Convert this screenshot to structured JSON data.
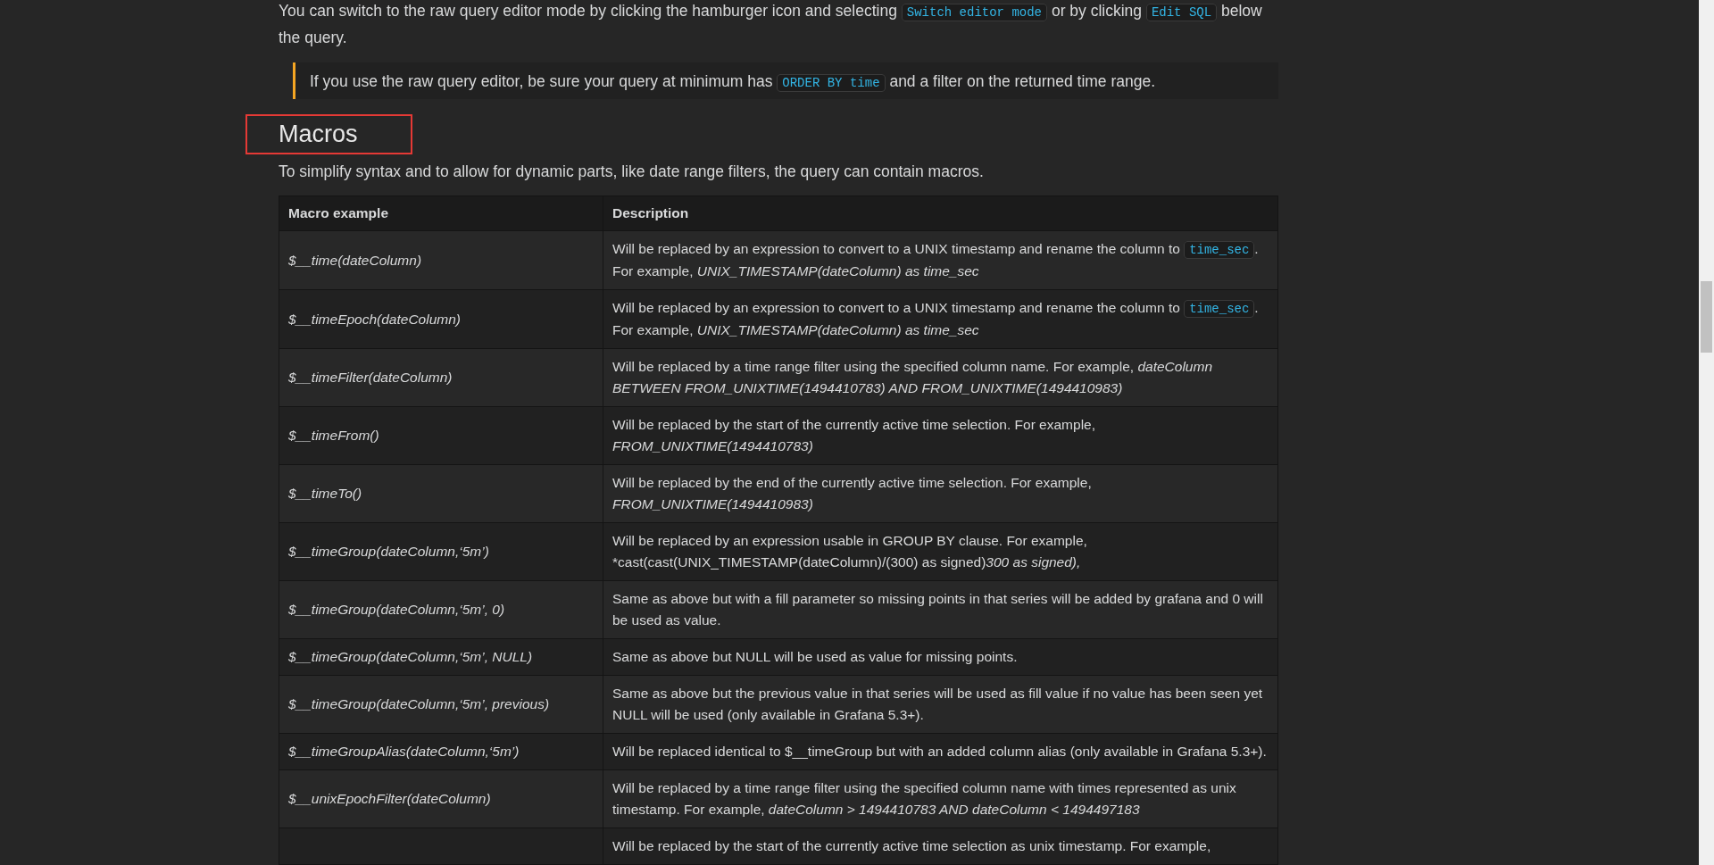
{
  "intro": [
    {
      "kind": "text",
      "text": "You can switch to the raw query editor mode by clicking the hamburger icon and selecting "
    },
    {
      "kind": "code",
      "text": "Switch editor mode"
    },
    {
      "kind": "text",
      "text": " or by clicking "
    },
    {
      "kind": "code",
      "text": "Edit SQL"
    },
    {
      "kind": "text",
      "text": " below the query."
    }
  ],
  "note": [
    {
      "kind": "text",
      "text": "If you use the raw query editor, be sure your query at minimum has "
    },
    {
      "kind": "code",
      "text": "ORDER BY time"
    },
    {
      "kind": "text",
      "text": " and a filter on the returned time range."
    }
  ],
  "heading": {
    "text": "Macros",
    "highlighted": true
  },
  "lead": "To simplify syntax and to allow for dynamic parts, like date range filters, the query can contain macros.",
  "table": {
    "columns": [
      "Macro example",
      "Description"
    ],
    "rows": [
      {
        "macro": "$__time(dateColumn)",
        "description": [
          {
            "kind": "text",
            "text": "Will be replaced by an expression to convert to a UNIX timestamp and rename the column to "
          },
          {
            "kind": "code",
            "text": "time_sec"
          },
          {
            "kind": "text",
            "text": ". For example, "
          },
          {
            "kind": "italic",
            "text": "UNIX_TIMESTAMP(dateColumn) as time_sec"
          }
        ]
      },
      {
        "macro": "$__timeEpoch(dateColumn)",
        "description": [
          {
            "kind": "text",
            "text": "Will be replaced by an expression to convert to a UNIX timestamp and rename the column to "
          },
          {
            "kind": "code",
            "text": "time_sec"
          },
          {
            "kind": "text",
            "text": ". For example, "
          },
          {
            "kind": "italic",
            "text": "UNIX_TIMESTAMP(dateColumn) as time_sec"
          }
        ]
      },
      {
        "macro": "$__timeFilter(dateColumn)",
        "description": [
          {
            "kind": "text",
            "text": "Will be replaced by a time range filter using the specified column name. For example, "
          },
          {
            "kind": "italic",
            "text": "dateColumn BETWEEN FROM_UNIXTIME(1494410783) AND FROM_UNIXTIME(1494410983)"
          }
        ]
      },
      {
        "macro": "$__timeFrom()",
        "description": [
          {
            "kind": "text",
            "text": "Will be replaced by the start of the currently active time selection. For example, "
          },
          {
            "kind": "italic",
            "text": "FROM_UNIXTIME(1494410783)"
          }
        ]
      },
      {
        "macro": "$__timeTo()",
        "description": [
          {
            "kind": "text",
            "text": "Will be replaced by the end of the currently active time selection. For example, "
          },
          {
            "kind": "italic",
            "text": "FROM_UNIXTIME(1494410983)"
          }
        ]
      },
      {
        "macro": "$__timeGroup(dateColumn,‘5m’)",
        "description": [
          {
            "kind": "text",
            "text": "Will be replaced by an expression usable in GROUP BY clause. For example, *cast(cast(UNIX_TIMESTAMP(dateColumn)/(300) as signed)"
          },
          {
            "kind": "italic",
            "text": "300 as signed),"
          }
        ]
      },
      {
        "macro": "$__timeGroup(dateColumn,‘5m’, 0)",
        "description": [
          {
            "kind": "text",
            "text": "Same as above but with a fill parameter so missing points in that series will be added by grafana and 0 will be used as value."
          }
        ]
      },
      {
        "macro": "$__timeGroup(dateColumn,‘5m’, NULL)",
        "description": [
          {
            "kind": "text",
            "text": "Same as above but NULL will be used as value for missing points."
          }
        ]
      },
      {
        "macro": "$__timeGroup(dateColumn,‘5m’, previous)",
        "description": [
          {
            "kind": "text",
            "text": "Same as above but the previous value in that series will be used as fill value if no value has been seen yet NULL will be used (only available in Grafana 5.3+)."
          }
        ]
      },
      {
        "macro": "$__timeGroupAlias(dateColumn,‘5m’)",
        "description": [
          {
            "kind": "text",
            "text": "Will be replaced identical to $__timeGroup but with an added column alias (only available in Grafana 5.3+)."
          }
        ]
      },
      {
        "macro": "$__unixEpochFilter(dateColumn)",
        "description": [
          {
            "kind": "text",
            "text": "Will be replaced by a time range filter using the specified column name with times represented as unix timestamp. For example, "
          },
          {
            "kind": "italic",
            "text": "dateColumn > 1494410783 AND dateColumn < 1494497183"
          }
        ]
      },
      {
        "description": [
          {
            "kind": "text",
            "text": "Will be replaced by the start of the currently active time selection as unix timestamp. For example,"
          }
        ]
      }
    ]
  }
}
